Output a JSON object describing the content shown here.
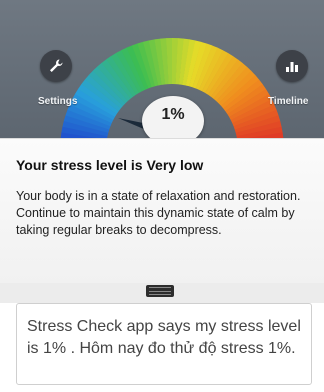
{
  "header": {
    "settings_label": "Settings",
    "timeline_label": "Timeline",
    "stress_percent": "1%",
    "stress_value": 0.01
  },
  "card": {
    "title": "Your stress level is Very low",
    "body": "Your body is in a state of relaxation and restoration. Continue to maintain this dynamic state of calm by taking regular breaks to decompress."
  },
  "compose": {
    "text": "Stress Check app says my stress level is 1% . Hôm nay đo thử độ stress 1%."
  },
  "icons": {
    "settings": "wrench-icon",
    "timeline": "bar-chart-icon"
  }
}
